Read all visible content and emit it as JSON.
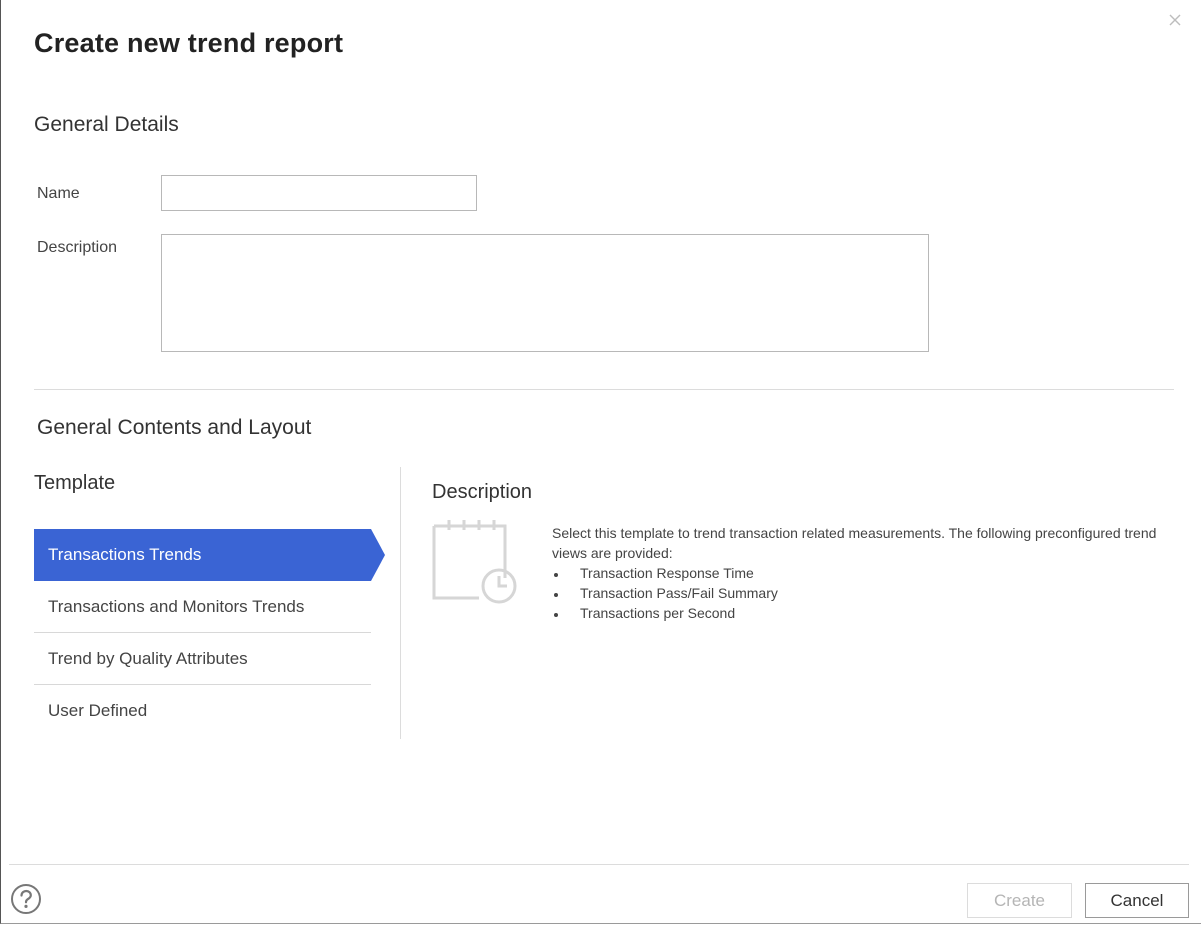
{
  "dialog": {
    "title": "Create new trend report",
    "close_icon": "close-icon"
  },
  "general_details": {
    "heading": "General Details",
    "name_label": "Name",
    "name_value": "",
    "description_label": "Description",
    "description_value": ""
  },
  "contents": {
    "heading": "General Contents and Layout",
    "template_heading": "Template",
    "templates": [
      {
        "label": "Transactions Trends",
        "selected": true
      },
      {
        "label": "Transactions and Monitors Trends",
        "selected": false
      },
      {
        "label": "Trend by Quality Attributes",
        "selected": false
      },
      {
        "label": "User Defined",
        "selected": false
      }
    ],
    "description_heading": "Description",
    "description_icon": "calendar-clock-icon",
    "description_text": "Select this template to trend transaction related measurements. The following preconfigured trend views are provided:",
    "description_items": [
      "Transaction Response Time",
      "Transaction Pass/Fail Summary",
      "Transactions per Second"
    ]
  },
  "footer": {
    "help_icon": "help-icon",
    "create_label": "Create",
    "cancel_label": "Cancel"
  },
  "colors": {
    "accent": "#3a64d4",
    "border": "#b8b8b8",
    "disabled_text": "#b5b5b5"
  }
}
